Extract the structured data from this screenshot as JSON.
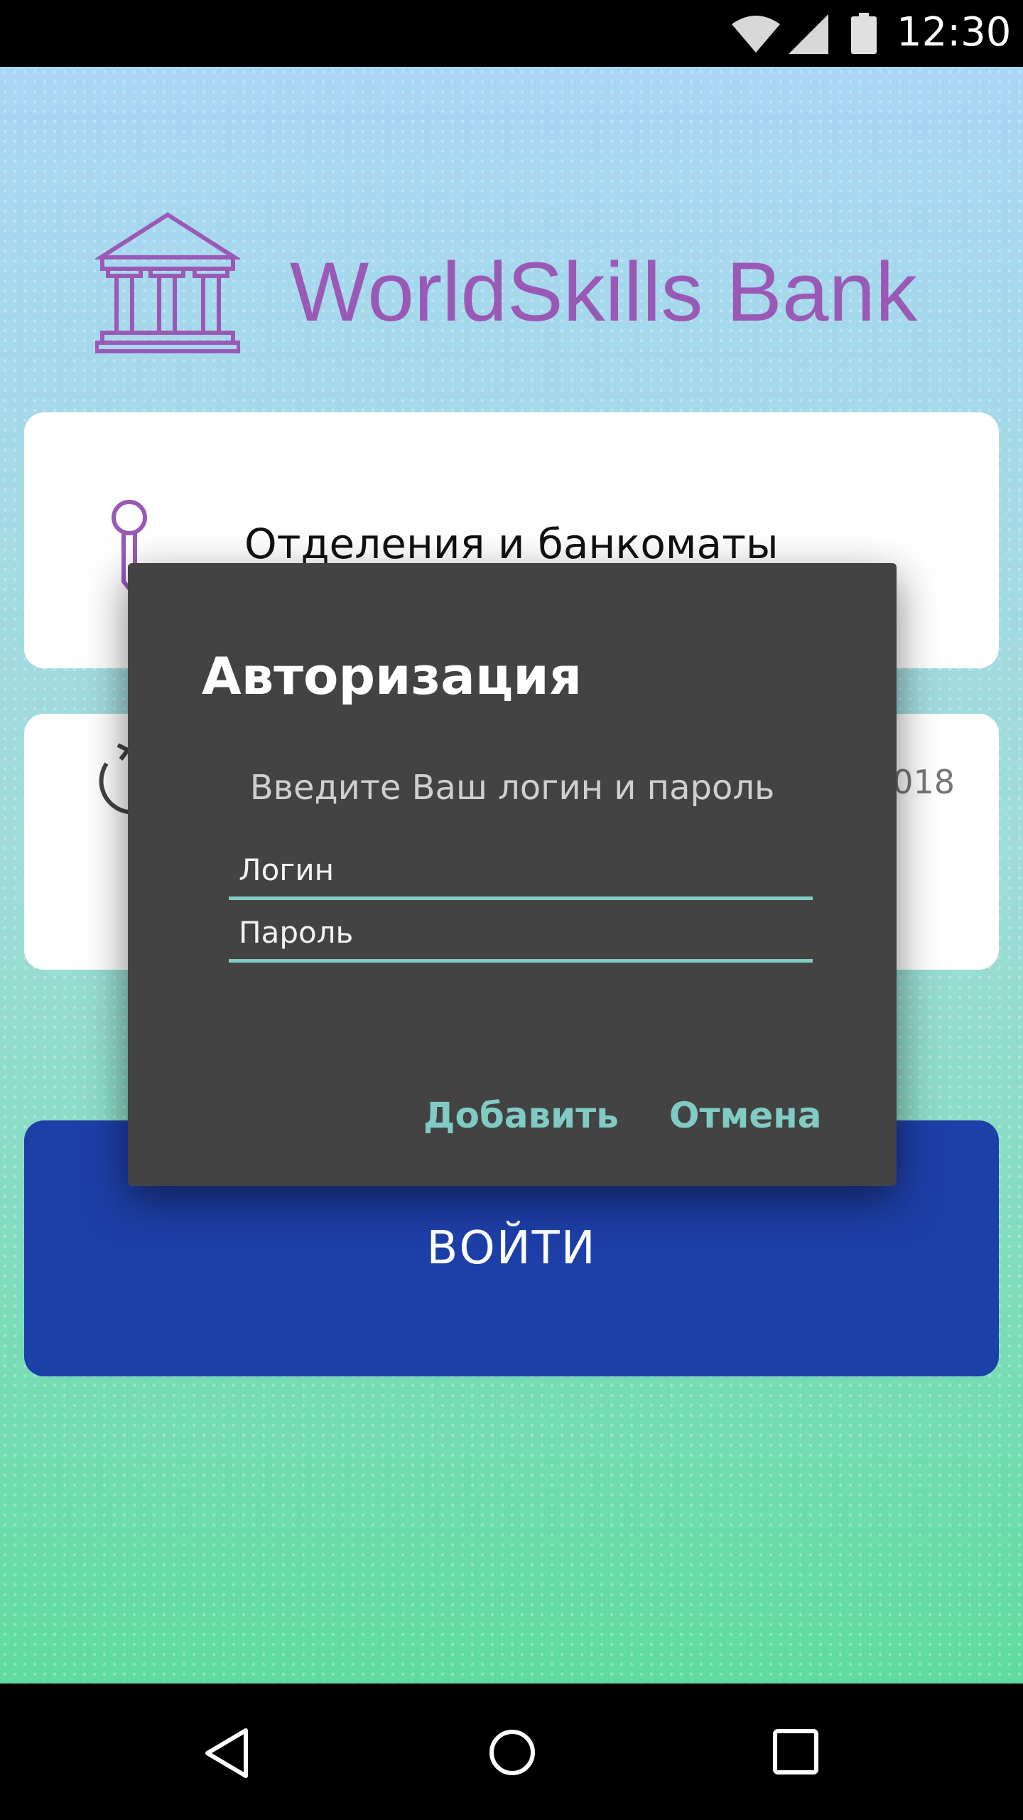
{
  "status_bar": {
    "time": "12:30",
    "icons": [
      "wifi-icon",
      "signal-icon",
      "battery-icon"
    ]
  },
  "app": {
    "bank_name": "WorldSkills Bank",
    "cards": [
      {
        "label": "Отделения и банкоматы",
        "icon": "map-pin-icon"
      },
      {
        "date": "2018",
        "icon": "refresh-clock-icon"
      }
    ],
    "login_button_label": "ВОЙТИ"
  },
  "dialog": {
    "title": "Авторизация",
    "message": "Введите Ваш логин и пароль",
    "login_placeholder": "Логин",
    "password_placeholder": "Пароль",
    "add_label": "Добавить",
    "cancel_label": "Отмена"
  },
  "colors": {
    "brand_purple": "#9b59b6",
    "button_blue": "#1d3fa8",
    "dialog_bg": "#434343",
    "accent_teal": "#80cbc4"
  },
  "nav_bar": {
    "icons": [
      "back-icon",
      "home-icon",
      "recents-icon"
    ]
  }
}
